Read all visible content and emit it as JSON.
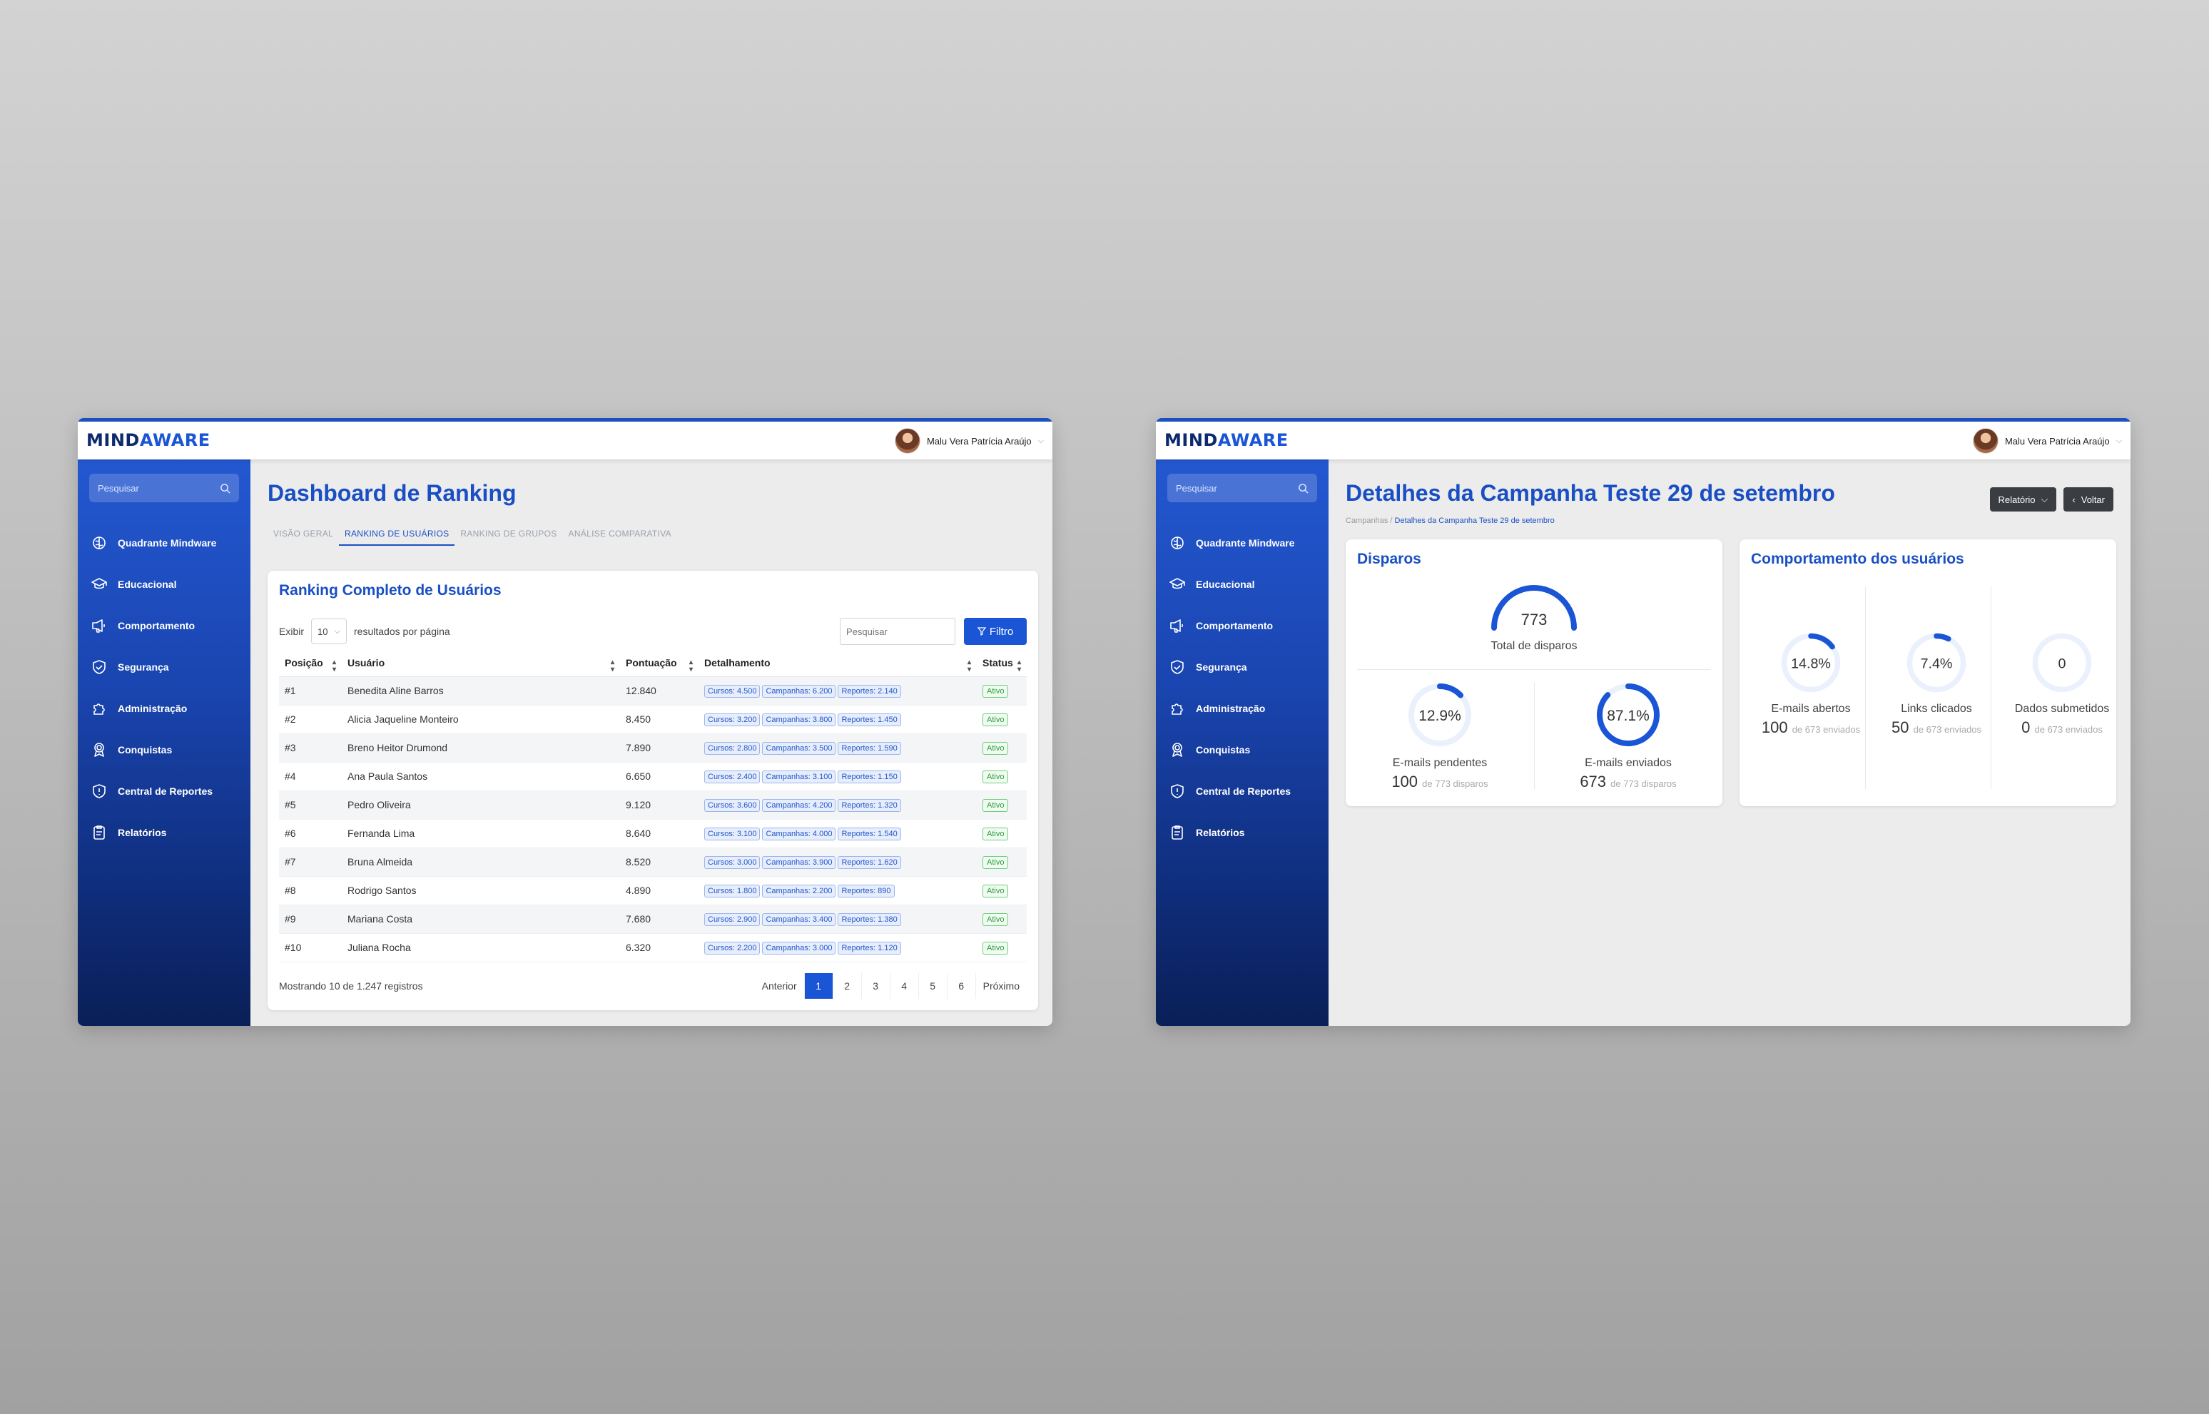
{
  "brand": {
    "mind": "MIND",
    "aware": "AWARE"
  },
  "user": {
    "name": "Malu Vera Patrícia Araújo"
  },
  "sidebar": {
    "search_placeholder": "Pesquisar",
    "items": [
      {
        "label": "Quadrante Mindware",
        "icon": "brain-icon"
      },
      {
        "label": "Educacional",
        "icon": "graduation-cap-icon"
      },
      {
        "label": "Comportamento",
        "icon": "megaphone-icon"
      },
      {
        "label": "Segurança",
        "icon": "shield-check-icon"
      },
      {
        "label": "Administração",
        "icon": "puzzle-icon"
      },
      {
        "label": "Conquistas",
        "icon": "award-icon"
      },
      {
        "label": "Central de Reportes",
        "icon": "shield-alert-icon"
      },
      {
        "label": "Relatórios",
        "icon": "clipboard-icon"
      }
    ]
  },
  "ranking": {
    "title": "Dashboard de Ranking",
    "tabs": [
      "VISÃO GERAL",
      "RANKING DE USUÁRIOS",
      "RANKING DE GRUPOS",
      "ANÁLISE COMPARATIVA"
    ],
    "active_tab": 1,
    "card_title": "Ranking Completo de Usuários",
    "show_label": "Exibir",
    "page_size": "10",
    "per_page_label": "resultados por página",
    "search_placeholder": "Pesquisar",
    "filter_label": "Filtro",
    "columns": [
      "Posição",
      "Usuário",
      "Pontuação",
      "Detalhamento",
      "Status"
    ],
    "rows": [
      {
        "pos": "#1",
        "user": "Benedita Aline Barros",
        "score": "12.840",
        "cursos": "Cursos: 4.500",
        "campanhas": "Campanhas: 6.200",
        "reportes": "Reportes: 2.140",
        "status": "Ativo"
      },
      {
        "pos": "#2",
        "user": "Alicia Jaqueline Monteiro",
        "score": "8.450",
        "cursos": "Cursos: 3.200",
        "campanhas": "Campanhas: 3.800",
        "reportes": "Reportes: 1.450",
        "status": "Ativo"
      },
      {
        "pos": "#3",
        "user": "Breno Heitor Drumond",
        "score": "7.890",
        "cursos": "Cursos: 2.800",
        "campanhas": "Campanhas: 3.500",
        "reportes": "Reportes: 1.590",
        "status": "Ativo"
      },
      {
        "pos": "#4",
        "user": "Ana Paula Santos",
        "score": "6.650",
        "cursos": "Cursos: 2.400",
        "campanhas": "Campanhas: 3.100",
        "reportes": "Reportes: 1.150",
        "status": "Ativo"
      },
      {
        "pos": "#5",
        "user": "Pedro Oliveira",
        "score": "9.120",
        "cursos": "Cursos: 3.600",
        "campanhas": "Campanhas: 4.200",
        "reportes": "Reportes: 1.320",
        "status": "Ativo"
      },
      {
        "pos": "#6",
        "user": "Fernanda Lima",
        "score": "8.640",
        "cursos": "Cursos: 3.100",
        "campanhas": "Campanhas: 4.000",
        "reportes": "Reportes: 1.540",
        "status": "Ativo"
      },
      {
        "pos": "#7",
        "user": "Bruna Almeida",
        "score": "8.520",
        "cursos": "Cursos: 3.000",
        "campanhas": "Campanhas: 3.900",
        "reportes": "Reportes: 1.620",
        "status": "Ativo"
      },
      {
        "pos": "#8",
        "user": "Rodrigo Santos",
        "score": "4.890",
        "cursos": "Cursos: 1.800",
        "campanhas": "Campanhas: 2.200",
        "reportes": "Reportes: 890",
        "status": "Ativo"
      },
      {
        "pos": "#9",
        "user": "Mariana Costa",
        "score": "7.680",
        "cursos": "Cursos: 2.900",
        "campanhas": "Campanhas: 3.400",
        "reportes": "Reportes: 1.380",
        "status": "Ativo"
      },
      {
        "pos": "#10",
        "user": "Juliana Rocha",
        "score": "6.320",
        "cursos": "Cursos: 2.200",
        "campanhas": "Campanhas: 3.000",
        "reportes": "Reportes: 1.120",
        "status": "Ativo"
      }
    ],
    "footer_text": "Mostrando 10 de 1.247 registros",
    "pager": {
      "prev": "Anterior",
      "pages": [
        "1",
        "2",
        "3",
        "4",
        "5",
        "6"
      ],
      "active": 0,
      "next": "Próximo"
    }
  },
  "campaign": {
    "title": "Detalhes da Campanha Teste 29 de setembro",
    "breadcrumb": {
      "root": "Campanhas",
      "sep": "/",
      "current": "Detalhes da Campanha Teste 29 de setembro"
    },
    "report_button": "Relatório",
    "back_button": "Voltar",
    "disparos": {
      "title": "Disparos",
      "total_value": "773",
      "total_label": "Total de disparos",
      "pending": {
        "percent_label": "12.9%",
        "fraction": 0.129,
        "label": "E-mails pendentes",
        "count": "100",
        "of": "de 773 disparos"
      },
      "sent": {
        "percent_label": "87.1%",
        "fraction": 0.871,
        "label": "E-mails enviados",
        "count": "673",
        "of": "de 773 disparos"
      }
    },
    "behavior": {
      "title": "Comportamento dos usuários",
      "metrics": [
        {
          "percent_label": "14.8%",
          "fraction": 0.148,
          "label": "E-mails abertos",
          "count": "100",
          "of": "de 673 enviados"
        },
        {
          "percent_label": "7.4%",
          "fraction": 0.074,
          "label": "Links clicados",
          "count": "50",
          "of": "de 673 enviados"
        },
        {
          "percent_label": "0",
          "fraction": 0,
          "label": "Dados submetidos",
          "count": "0",
          "of": "de 673 enviados"
        }
      ]
    }
  },
  "colors": {
    "primary": "#1a55d6",
    "title": "#1a4fc4",
    "sidebar_top": "#2358d1",
    "sidebar_bottom": "#0a1f57",
    "success": "#2e9d3a"
  }
}
